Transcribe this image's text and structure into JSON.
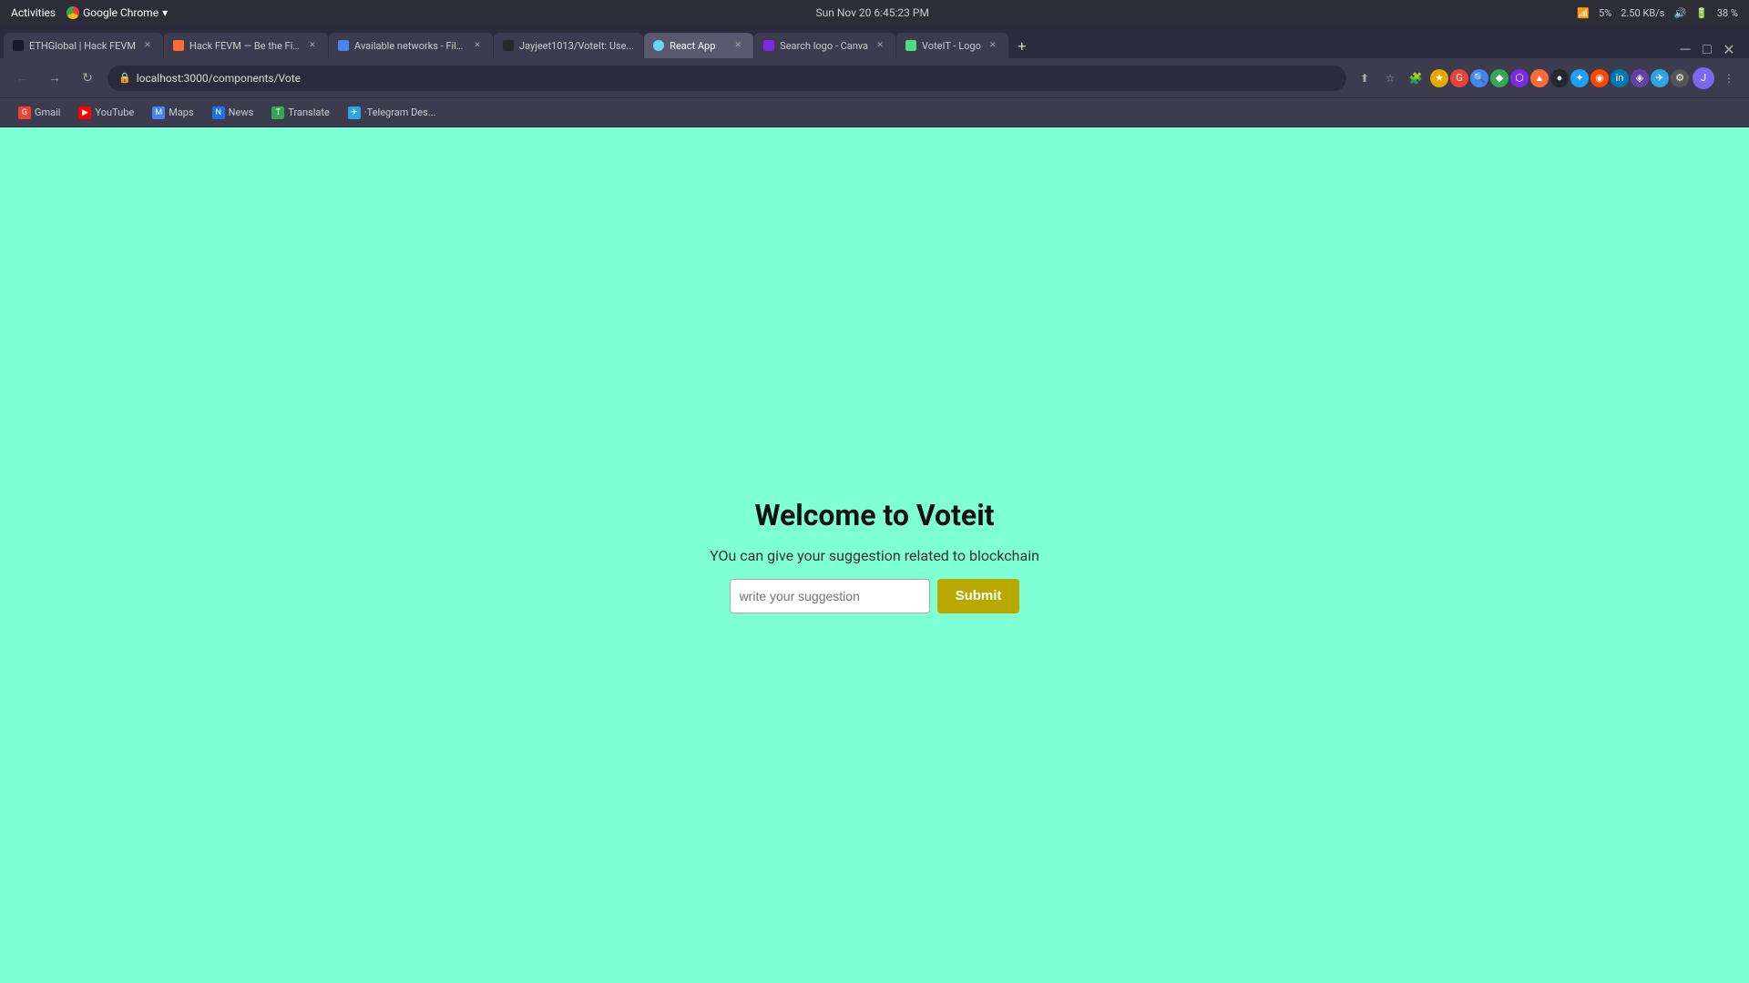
{
  "os": {
    "activities": "Activities",
    "browser_label": "Google Chrome",
    "datetime": "Sun Nov 20   6:45:23 PM",
    "battery": "38 %",
    "network_speed": "2.50 KB/s",
    "wifi_pct": "5%"
  },
  "browser": {
    "tabs": [
      {
        "id": "tab1",
        "label": "ETHGlobal | Hack FEVM",
        "active": false,
        "has_close": true
      },
      {
        "id": "tab2",
        "label": "Hack FEVM — Be the Fir...",
        "active": false,
        "has_close": true
      },
      {
        "id": "tab3",
        "label": "Available networks - File...",
        "active": false,
        "has_close": true
      },
      {
        "id": "tab4",
        "label": "Jayjeet1013/VoteIt: Use...",
        "active": false,
        "has_close": false
      },
      {
        "id": "tab5",
        "label": "React App",
        "active": true,
        "has_close": true
      },
      {
        "id": "tab6",
        "label": "Search logo - Canva",
        "active": false,
        "has_close": true
      },
      {
        "id": "tab7",
        "label": "VoteIT - Logo",
        "active": false,
        "has_close": true
      }
    ],
    "url": "localhost:3000/components/Vote",
    "bookmarks": [
      {
        "id": "gmail",
        "label": "Gmail",
        "icon_text": "G",
        "color": "#ea4335"
      },
      {
        "id": "youtube",
        "label": "YouTube",
        "icon_text": "▶",
        "color": "#ff0000"
      },
      {
        "id": "maps",
        "label": "Maps",
        "icon_text": "M",
        "color": "#4285f4"
      },
      {
        "id": "news",
        "label": "News",
        "icon_text": "N",
        "color": "#1a73e8"
      },
      {
        "id": "translate",
        "label": "Translate",
        "icon_text": "T",
        "color": "#34a853"
      },
      {
        "id": "telegram",
        "label": "·Telegram Des...",
        "icon_text": "✈",
        "color": "#2ca5e0"
      }
    ]
  },
  "page": {
    "background_color": "#7fffd4",
    "title": "Welcome to Voteit",
    "subtitle": "YOu can give your suggestion related to blockchain",
    "input_placeholder": "write your suggestion",
    "submit_label": "Submit"
  }
}
